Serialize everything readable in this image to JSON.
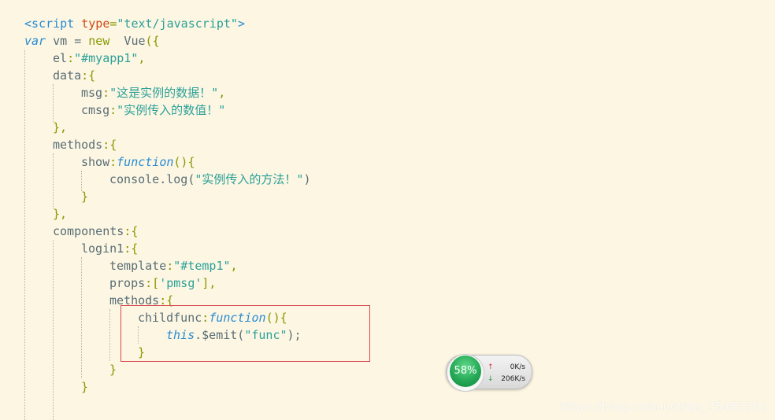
{
  "editor": {
    "lines": [
      {
        "parts": [
          {
            "c": "t-tag",
            "t": "<script "
          },
          {
            "c": "t-attr",
            "t": "type"
          },
          {
            "c": "t-punc",
            "t": "="
          },
          {
            "c": "t-str",
            "t": "\"text/javascript\""
          },
          {
            "c": "t-tag",
            "t": ">"
          }
        ]
      },
      {
        "parts": [
          {
            "c": "t-kw",
            "t": "var"
          },
          {
            "c": "t-id",
            "t": " vm = "
          },
          {
            "c": "t-new",
            "t": "new"
          },
          {
            "c": "t-id",
            "t": "  Vue"
          },
          {
            "c": "t-punc",
            "t": "({"
          }
        ]
      },
      {
        "parts": [
          {
            "c": "t-prop",
            "t": "el"
          },
          {
            "c": "t-punc",
            "t": ":"
          },
          {
            "c": "t-str",
            "t": "\"#myapp1\""
          },
          {
            "c": "t-punc",
            "t": ","
          }
        ]
      },
      {
        "parts": [
          {
            "c": "t-prop",
            "t": "data"
          },
          {
            "c": "t-punc",
            "t": ":{"
          }
        ]
      },
      {
        "parts": [
          {
            "c": "t-prop",
            "t": "msg"
          },
          {
            "c": "t-punc",
            "t": ":"
          },
          {
            "c": "t-str",
            "t": "\"这是实例的数据！\""
          },
          {
            "c": "t-punc",
            "t": ","
          }
        ]
      },
      {
        "parts": [
          {
            "c": "t-prop",
            "t": "cmsg"
          },
          {
            "c": "t-punc",
            "t": ":"
          },
          {
            "c": "t-str",
            "t": "\"实例传入的数值！\""
          }
        ]
      },
      {
        "parts": [
          {
            "c": "t-punc",
            "t": "},"
          }
        ]
      },
      {
        "parts": [
          {
            "c": "t-prop",
            "t": "methods"
          },
          {
            "c": "t-punc",
            "t": ":{"
          }
        ]
      },
      {
        "parts": [
          {
            "c": "t-prop",
            "t": "show"
          },
          {
            "c": "t-punc",
            "t": ":"
          },
          {
            "c": "t-kw",
            "t": "function"
          },
          {
            "c": "t-punc",
            "t": "(){"
          }
        ]
      },
      {
        "parts": [
          {
            "c": "t-prop",
            "t": "console.log("
          },
          {
            "c": "t-str",
            "t": "\"实例传入的方法！\""
          },
          {
            "c": "t-prop",
            "t": ")"
          }
        ]
      },
      {
        "parts": [
          {
            "c": "t-punc",
            "t": "}"
          }
        ]
      },
      {
        "parts": [
          {
            "c": "t-punc",
            "t": "},"
          }
        ]
      },
      {
        "parts": [
          {
            "c": "t-prop",
            "t": "components"
          },
          {
            "c": "t-punc",
            "t": ":{"
          }
        ]
      },
      {
        "parts": [
          {
            "c": "t-prop",
            "t": "login1"
          },
          {
            "c": "t-punc",
            "t": ":{"
          }
        ]
      },
      {
        "parts": [
          {
            "c": "t-prop",
            "t": "template"
          },
          {
            "c": "t-punc",
            "t": ":"
          },
          {
            "c": "t-str",
            "t": "\"#temp1\""
          },
          {
            "c": "t-punc",
            "t": ","
          }
        ]
      },
      {
        "parts": [
          {
            "c": "t-prop",
            "t": "props"
          },
          {
            "c": "t-punc",
            "t": ":["
          },
          {
            "c": "t-str",
            "t": "'pmsg'"
          },
          {
            "c": "t-punc",
            "t": "],"
          }
        ]
      },
      {
        "parts": [
          {
            "c": "t-prop",
            "t": "methods"
          },
          {
            "c": "t-punc",
            "t": ":{"
          }
        ]
      },
      {
        "parts": [
          {
            "c": "t-prop",
            "t": "childfunc"
          },
          {
            "c": "t-punc",
            "t": ":"
          },
          {
            "c": "t-kw",
            "t": "function"
          },
          {
            "c": "t-punc",
            "t": "(){"
          }
        ]
      },
      {
        "parts": [
          {
            "c": "t-this",
            "t": "this"
          },
          {
            "c": "t-prop",
            "t": ".$emit("
          },
          {
            "c": "t-str",
            "t": "\"func\""
          },
          {
            "c": "t-prop",
            "t": ");"
          }
        ]
      },
      {
        "parts": [
          {
            "c": "t-punc",
            "t": "}"
          }
        ]
      },
      {
        "parts": [
          {
            "c": "t-punc",
            "t": "}"
          }
        ]
      },
      {
        "parts": [
          {
            "c": "t-punc",
            "t": "}"
          }
        ]
      }
    ]
  },
  "network_widget": {
    "percent": "58%",
    "upload": "0K/s",
    "download": "206K/s",
    "up_arrow_icon": "arrow-up-icon",
    "down_arrow_icon": "arrow-down-icon"
  },
  "watermark": "https://blog.csdn.net/qq_35455562",
  "colors": {
    "background": "#fdf6e3",
    "highlight_border": "#d9464b",
    "gauge_green": "#25a957"
  }
}
